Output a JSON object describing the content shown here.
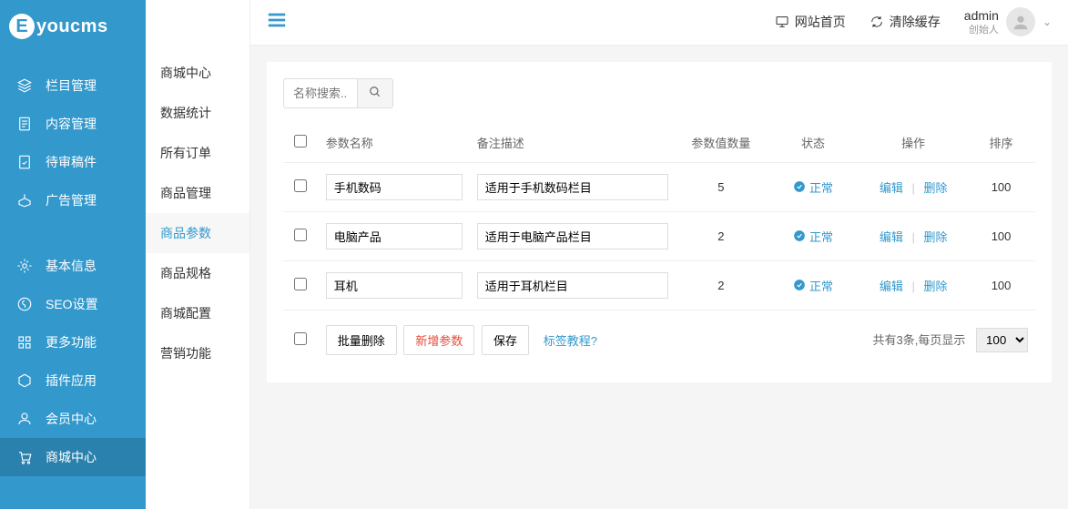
{
  "logo": "youcms",
  "sidebar": {
    "items": [
      {
        "label": "栏目管理",
        "icon": "stack"
      },
      {
        "label": "内容管理",
        "icon": "doc"
      },
      {
        "label": "待审稿件",
        "icon": "pending"
      },
      {
        "label": "广告管理",
        "icon": "ad"
      },
      {
        "label": "基本信息",
        "icon": "gear"
      },
      {
        "label": "SEO设置",
        "icon": "seo"
      },
      {
        "label": "更多功能",
        "icon": "more"
      },
      {
        "label": "插件应用",
        "icon": "plugin"
      },
      {
        "label": "会员中心",
        "icon": "user"
      },
      {
        "label": "商城中心",
        "icon": "cart"
      }
    ]
  },
  "subsidebar": {
    "items": [
      {
        "label": "商城中心"
      },
      {
        "label": "数据统计"
      },
      {
        "label": "所有订单"
      },
      {
        "label": "商品管理"
      },
      {
        "label": "商品参数"
      },
      {
        "label": "商品规格"
      },
      {
        "label": "商城配置"
      },
      {
        "label": "营销功能"
      }
    ],
    "activeIndex": 4
  },
  "header": {
    "homepage": "网站首页",
    "clearCache": "清除缓存",
    "userName": "admin",
    "userRole": "创始人"
  },
  "search": {
    "placeholder": "名称搜索..."
  },
  "table": {
    "headers": {
      "name": "参数名称",
      "desc": "备注描述",
      "count": "参数值数量",
      "status": "状态",
      "ops": "操作",
      "sort": "排序"
    },
    "statusLabel": "正常",
    "editLabel": "编辑",
    "deleteLabel": "删除",
    "rows": [
      {
        "name": "手机数码",
        "desc": "适用于手机数码栏目",
        "count": "5",
        "sort": "100"
      },
      {
        "name": "电脑产品",
        "desc": "适用于电脑产品栏目",
        "count": "2",
        "sort": "100"
      },
      {
        "name": "耳机",
        "desc": "适用于耳机栏目",
        "count": "2",
        "sort": "100"
      }
    ],
    "batchDelete": "批量删除",
    "addNew": "新增参数",
    "save": "保存",
    "tutorial": "标签教程?",
    "totalText": "共有3条,每页显示",
    "perPage": "100"
  }
}
